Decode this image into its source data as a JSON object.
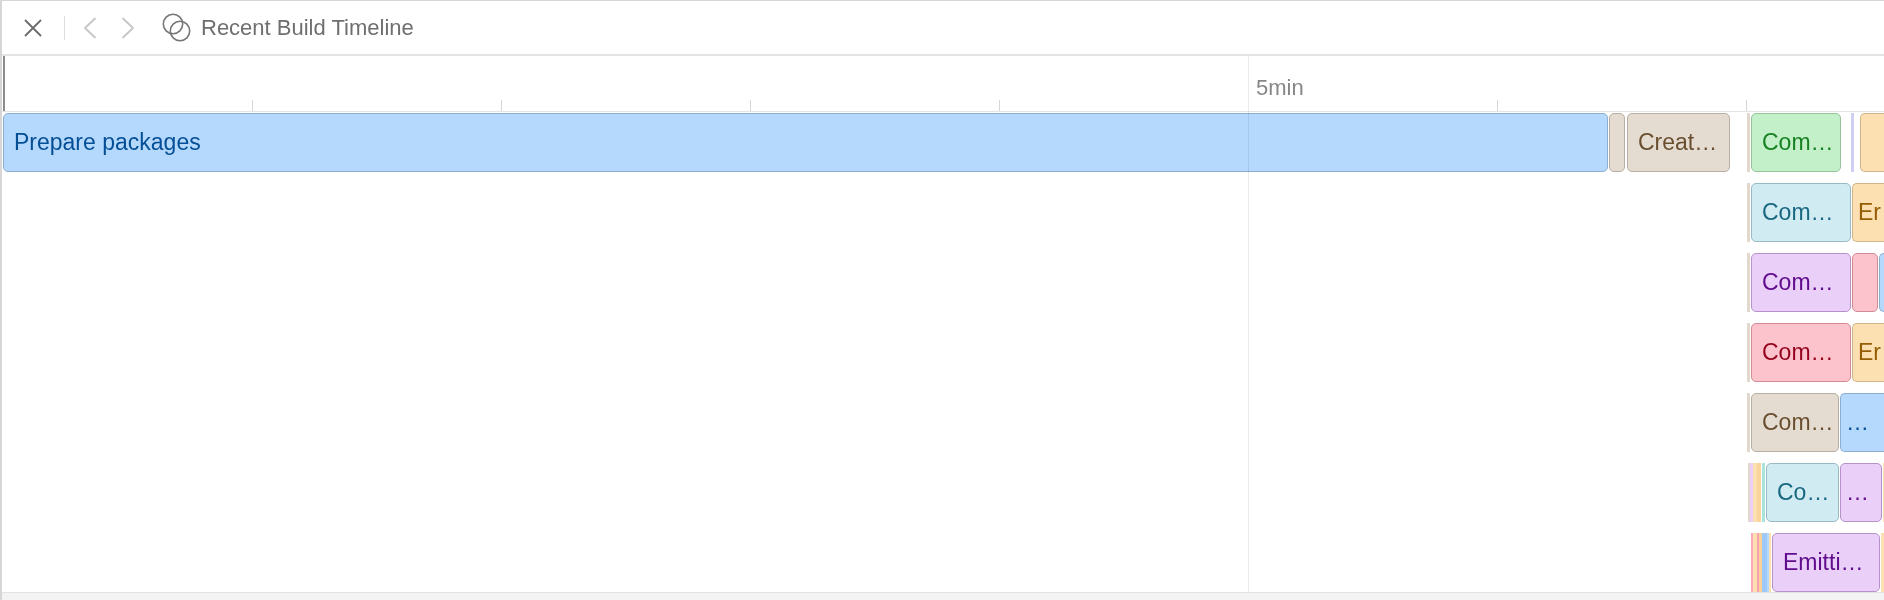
{
  "toolbar": {
    "back": {
      "disabled": true
    },
    "forward": {
      "disabled": true
    },
    "title": "Recent Build Timeline"
  },
  "ruler": {
    "label": "5min"
  },
  "rows": [
    {
      "tasks": [
        {
          "label": "Prepare packages",
          "color": "#b5d9fc"
        },
        {
          "color": "#e5dcd1"
        },
        {
          "label": "Creat…",
          "color": "#e5dcd1"
        },
        {
          "color": "#e2d8cc"
        },
        {
          "label": "Com…",
          "color": "#c3f0c8"
        },
        {
          "color": "#cfcff5"
        },
        {
          "color": "#fde0b2"
        }
      ]
    },
    {
      "tasks": [
        {
          "color": "#e2d8cc"
        },
        {
          "label": "Com…",
          "color": "#d1ebf3"
        },
        {
          "label": "Er",
          "color": "#fde0b2"
        }
      ]
    },
    {
      "tasks": [
        {
          "color": "#e2d8cc"
        },
        {
          "label": "Com…",
          "color": "#ead0f8"
        },
        {
          "color": "#fdc3cd"
        },
        {
          "color": "#b5d9fc"
        }
      ]
    },
    {
      "tasks": [
        {
          "color": "#e2d8cc"
        },
        {
          "label": "Com…",
          "color": "#fdc3cd"
        },
        {
          "label": "Er",
          "color": "#fde0b2"
        }
      ]
    },
    {
      "tasks": [
        {
          "color": "#e2d8cc"
        },
        {
          "label": "Com…",
          "color": "#e5dcd1"
        },
        {
          "label": "…",
          "color": "#b5d9fc"
        }
      ]
    },
    {
      "tasks": [
        {
          "color": "#e2d8cc"
        },
        {
          "color": "#ead0f8"
        },
        {
          "color": "#fde0b2"
        },
        {
          "color": "#fad49c"
        },
        {
          "color": "#a8e3dc"
        },
        {
          "label": "Co…",
          "color": "#d1ebf3"
        },
        {
          "label": "…",
          "color": "#ead0f8"
        },
        {
          "color": "#fde0b2"
        }
      ]
    },
    {
      "tasks": [
        {
          "color": "#f9a9b8"
        },
        {
          "color": "#fde0b2"
        },
        {
          "color": "#f7a0b0"
        },
        {
          "color": "#fbd39a"
        },
        {
          "color": "#9ec8f5"
        },
        {
          "color": "#b5d9fc"
        },
        {
          "color": "#fde0b2"
        },
        {
          "label": "Emitti…",
          "color": "#ead0f8"
        },
        {
          "color": "#fde0b2"
        }
      ]
    }
  ]
}
